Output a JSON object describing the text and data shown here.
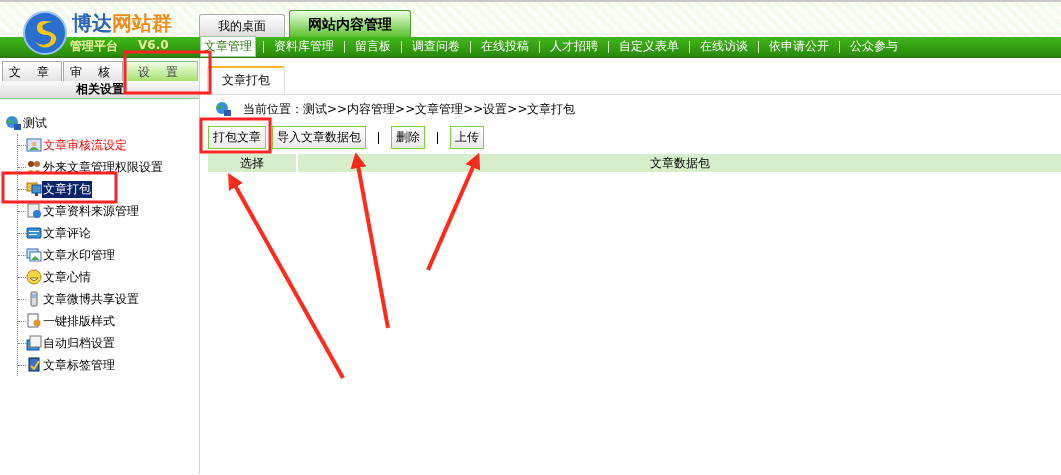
{
  "logo": {
    "brand_part_1": "博达",
    "brand_part_2": "网站群",
    "platform": "管理平台",
    "version": "V6.0"
  },
  "top_tabs": [
    {
      "label": "我的桌面",
      "selected": false
    },
    {
      "label": "网站内容管理",
      "selected": true
    }
  ],
  "menu": [
    {
      "label": "文章管理",
      "selected": true
    },
    {
      "label": "资料库管理",
      "selected": false
    },
    {
      "label": "留言板",
      "selected": false
    },
    {
      "label": "调查问卷",
      "selected": false
    },
    {
      "label": "在线投稿",
      "selected": false
    },
    {
      "label": "人才招聘",
      "selected": false
    },
    {
      "label": "自定义表单",
      "selected": false
    },
    {
      "label": "在线访谈",
      "selected": false
    },
    {
      "label": "依申请公开",
      "selected": false
    },
    {
      "label": "公众参与",
      "selected": false
    }
  ],
  "side_tabs": [
    {
      "label": "文 章",
      "selected": false
    },
    {
      "label": "审 核",
      "selected": false
    },
    {
      "label": "设 置",
      "selected": true
    }
  ],
  "side_header": "相关设置",
  "tree": {
    "label": "测试",
    "children": [
      {
        "label": "文章审核流设定",
        "emphasized": true,
        "selected": false
      },
      {
        "label": "外来文章管理权限设置",
        "emphasized": false,
        "selected": false
      },
      {
        "label": "文章打包",
        "emphasized": false,
        "selected": true
      },
      {
        "label": "文章资料来源管理",
        "emphasized": false,
        "selected": false
      },
      {
        "label": "文章评论",
        "emphasized": false,
        "selected": false
      },
      {
        "label": "文章水印管理",
        "emphasized": false,
        "selected": false
      },
      {
        "label": "文章心情",
        "emphasized": false,
        "selected": false
      },
      {
        "label": "文章微博共享设置",
        "emphasized": false,
        "selected": false
      },
      {
        "label": "一键排版样式",
        "emphasized": false,
        "selected": false
      },
      {
        "label": "自动归档设置",
        "emphasized": false,
        "selected": false
      },
      {
        "label": "文章标签管理",
        "emphasized": false,
        "selected": false
      }
    ]
  },
  "content_tabs": [
    {
      "label": "文章打包",
      "selected": true
    }
  ],
  "breadcrumb": "当前位置：测试>>内容管理>>文章管理>>设置>>文章打包",
  "toolbar": [
    {
      "kind": "button",
      "label": "打包文章"
    },
    {
      "kind": "button",
      "label": "导入文章数据包"
    },
    {
      "kind": "separator"
    },
    {
      "kind": "button",
      "label": "删除"
    },
    {
      "kind": "separator"
    },
    {
      "kind": "button",
      "label": "上传"
    }
  ],
  "table": {
    "columns": [
      "选择",
      "文章数据包"
    ]
  }
}
